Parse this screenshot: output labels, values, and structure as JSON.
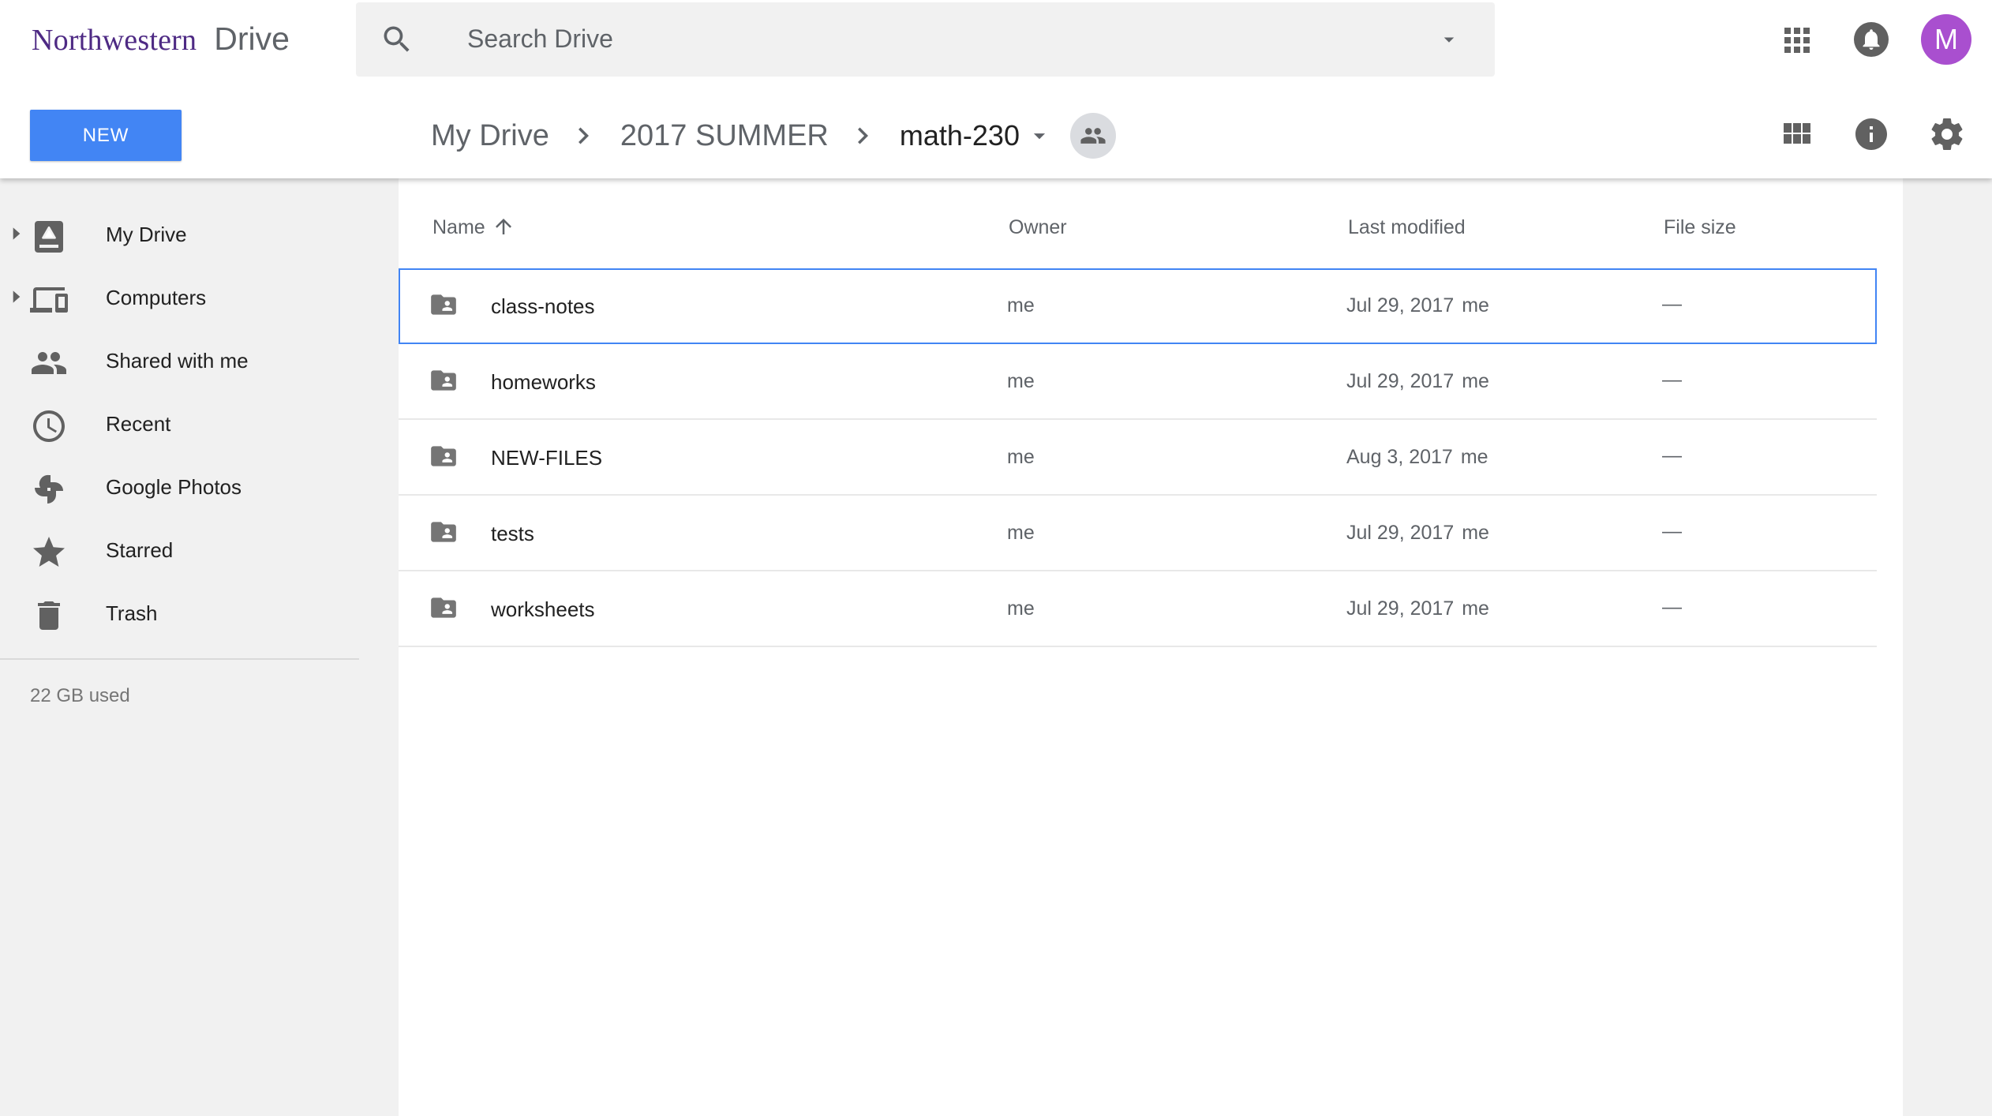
{
  "brand": {
    "org": "Northwestern",
    "product": "Drive"
  },
  "search": {
    "placeholder": "Search Drive"
  },
  "header": {
    "avatar_letter": "M",
    "new_label": "NEW"
  },
  "breadcrumb": {
    "root": "My Drive",
    "parent": "2017 SUMMER",
    "current": "math-230"
  },
  "sidebar": {
    "items": [
      {
        "label": "My Drive",
        "icon": "drive-icon"
      },
      {
        "label": "Computers",
        "icon": "computers-icon"
      },
      {
        "label": "Shared with me",
        "icon": "people-icon"
      },
      {
        "label": "Recent",
        "icon": "clock-icon"
      },
      {
        "label": "Google Photos",
        "icon": "pinwheel-icon"
      },
      {
        "label": "Starred",
        "icon": "star-icon"
      },
      {
        "label": "Trash",
        "icon": "trash-icon"
      }
    ],
    "storage": "22 GB used"
  },
  "table": {
    "headers": {
      "name": "Name",
      "owner": "Owner",
      "modified": "Last modified",
      "size": "File size"
    },
    "rows": [
      {
        "name": "class-notes",
        "owner": "me",
        "modified": "Jul 29, 2017",
        "modified_by": "me",
        "size": "—"
      },
      {
        "name": "homeworks",
        "owner": "me",
        "modified": "Jul 29, 2017",
        "modified_by": "me",
        "size": "—"
      },
      {
        "name": "NEW-FILES",
        "owner": "me",
        "modified": "Aug 3, 2017",
        "modified_by": "me",
        "size": "—"
      },
      {
        "name": "tests",
        "owner": "me",
        "modified": "Jul 29, 2017",
        "modified_by": "me",
        "size": "—"
      },
      {
        "name": "worksheets",
        "owner": "me",
        "modified": "Jul 29, 2017",
        "modified_by": "me",
        "size": "—"
      }
    ]
  },
  "colors": {
    "accent": "#4285f4",
    "brand_purple": "#4e2a84",
    "avatar": "#a94fcf",
    "icon_gray": "#616161"
  }
}
